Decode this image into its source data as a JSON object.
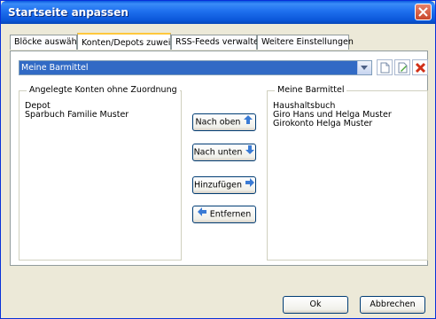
{
  "window": {
    "title": "Startseite anpassen"
  },
  "tabs": [
    {
      "label": "Blöcke auswählen"
    },
    {
      "label": "Konten/Depots zuweisen"
    },
    {
      "label": "RSS-Feeds verwalten"
    },
    {
      "label": "Weitere Einstellungen"
    }
  ],
  "combo": {
    "value": "Meine Barmittel"
  },
  "left_group": {
    "legend": "Angelegte Konten ohne Zuordnung",
    "items": [
      "Depot",
      "Sparbuch Familie Muster"
    ]
  },
  "right_group": {
    "legend": "Meine Barmittel",
    "items": [
      "Haushaltsbuch",
      "Giro Hans und Helga Muster",
      "Girokonto Helga Muster"
    ]
  },
  "buttons": {
    "up": "Nach oben",
    "down": "Nach unten",
    "add": "Hinzufügen",
    "remove": "Entfernen",
    "ok": "Ok",
    "cancel": "Abbrechen"
  },
  "colors": {
    "accent": "#316AC5",
    "title": "#0A5BDF"
  }
}
